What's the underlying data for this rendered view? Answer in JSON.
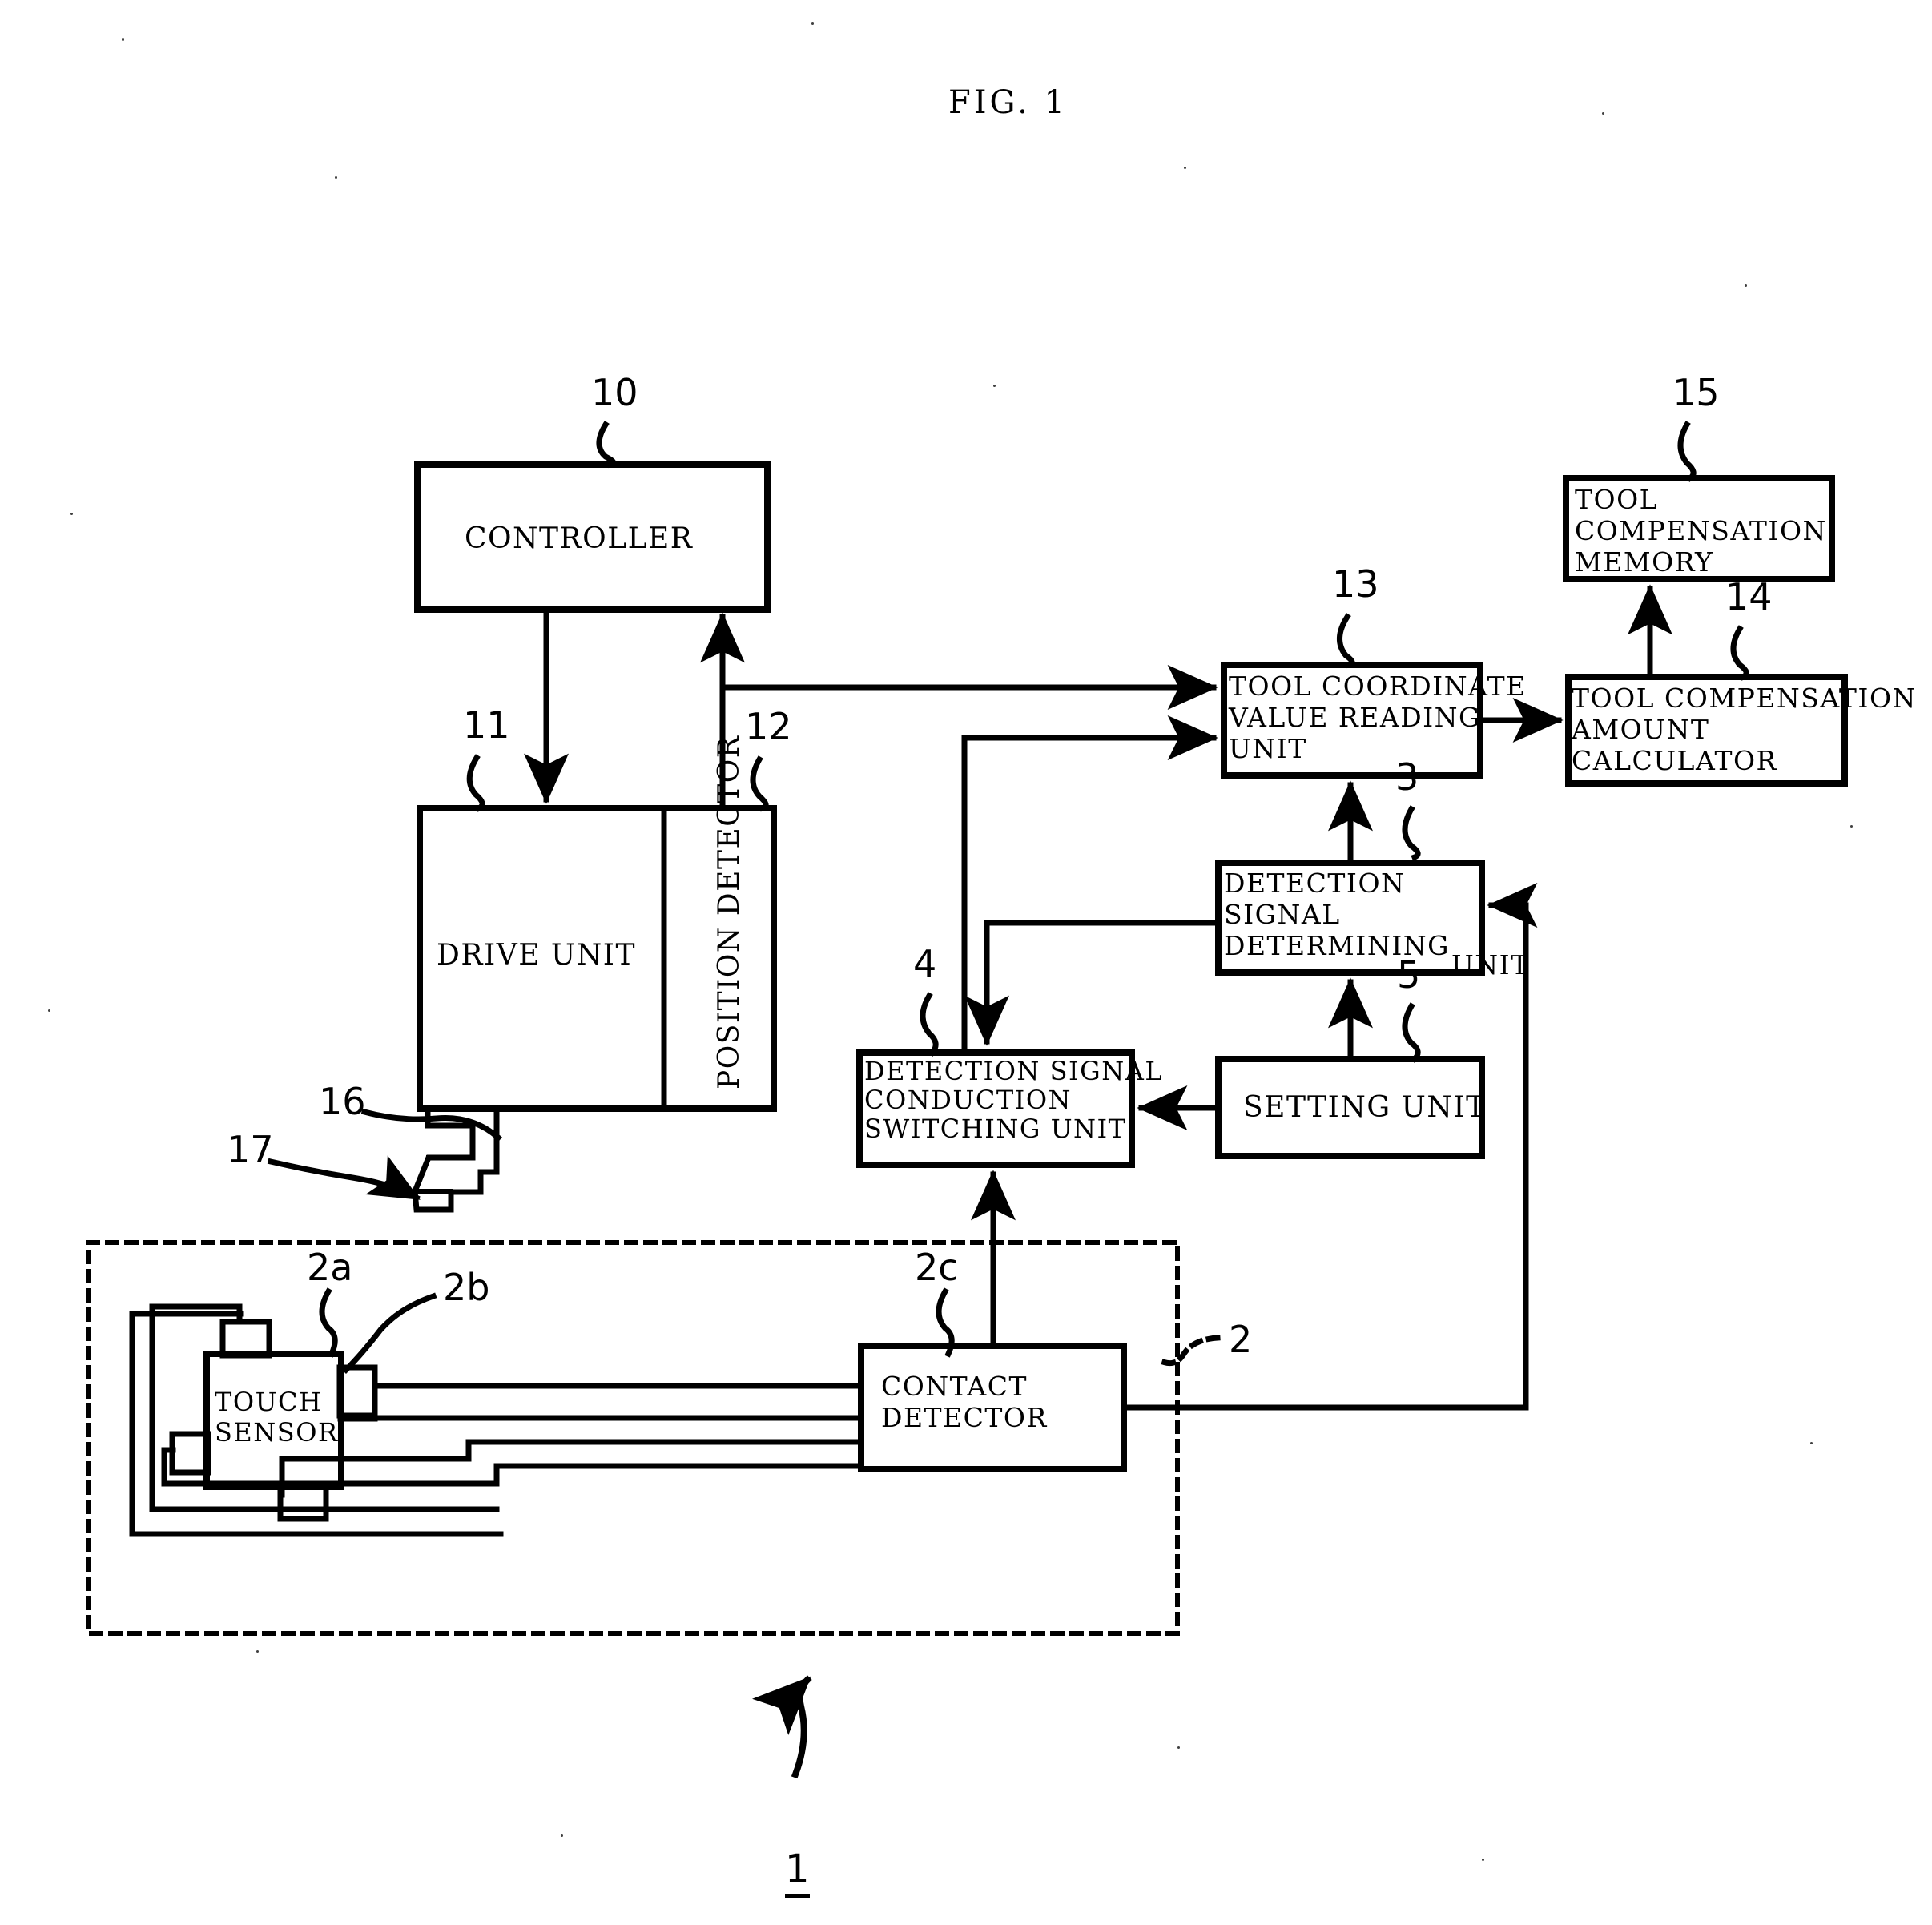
{
  "figure": {
    "title": "FIG. 1",
    "system_ref": "1"
  },
  "blocks": {
    "controller": {
      "label": "CONTROLLER",
      "ref": "10"
    },
    "drive_unit": {
      "label": "DRIVE UNIT",
      "ref": "11"
    },
    "position_detector": {
      "label": "POSITION DETECTOR",
      "ref": "12"
    },
    "tool_coordinate": {
      "label": "TOOL COORDINATE\nVALUE READING\nUNIT",
      "ref": "13"
    },
    "tool_comp_calc": {
      "label": "TOOL COMPENSATION\nAMOUNT\nCALCULATOR",
      "ref": "14"
    },
    "tool_comp_memory": {
      "label": "TOOL\nCOMPENSATION\nMEMORY",
      "ref": "15"
    },
    "det_sig_determine": {
      "label": "DETECTION\nSIGNAL\nDETERMINING",
      "label_overflow": "UNIT",
      "ref": "3"
    },
    "det_sig_switch": {
      "label": "DETECTION SIGNAL\nCONDUCTION\nSWITCHING UNIT",
      "ref": "4"
    },
    "setting_unit": {
      "label": "SETTING UNIT",
      "ref": "5"
    },
    "touch_sensor": {
      "label": "TOUCH\nSENSOR",
      "ref": "2a"
    },
    "sensor_contacts": {
      "label": "",
      "ref": "2b"
    },
    "contact_detector": {
      "label": "CONTACT\nDETECTOR",
      "ref": "2c"
    },
    "sensor_assembly": {
      "label": "",
      "ref": "2"
    },
    "tool_holder": {
      "label": "",
      "ref": "16"
    },
    "tool_tip": {
      "label": "",
      "ref": "17"
    }
  },
  "colors": {
    "ink": "#000000",
    "paper": "#ffffff"
  }
}
